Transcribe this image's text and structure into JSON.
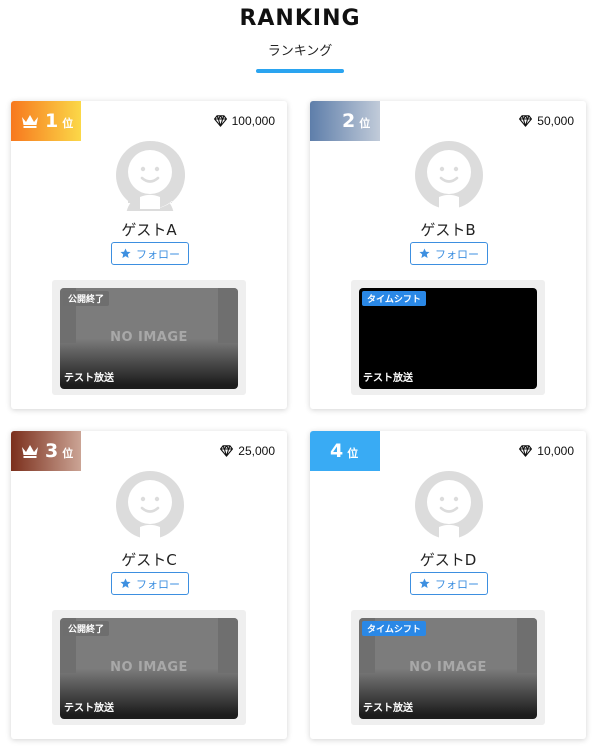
{
  "header": {
    "title": "RANKING",
    "subtitle": "ランキング"
  },
  "colors": {
    "accent": "#2aa4f0",
    "follow": "#3d8fe0",
    "rank1": [
      "#f7781e",
      "#fbd848"
    ],
    "rank2": [
      "#5e7eaa",
      "#c1cbd9"
    ],
    "rank3": [
      "#7b2f1c",
      "#cba495"
    ],
    "rank4": [
      "#39abf4",
      "#39abf4"
    ]
  },
  "cards": [
    {
      "rank": "1",
      "rank_unit": "位",
      "crown": true,
      "points": "100,000",
      "name": "ゲストA",
      "follow_label": "フォロー",
      "thumb_label": "公開終了",
      "thumb_title": "テスト放送",
      "no_image": "NO IMAGE"
    },
    {
      "rank": "2",
      "rank_unit": "位",
      "crown": false,
      "points": "50,000",
      "name": "ゲストB",
      "follow_label": "フォロー",
      "thumb_label": "タイムシフト",
      "thumb_title": "テスト放送",
      "no_image": ""
    },
    {
      "rank": "3",
      "rank_unit": "位",
      "crown": true,
      "points": "25,000",
      "name": "ゲストC",
      "follow_label": "フォロー",
      "thumb_label": "公開終了",
      "thumb_title": "テスト放送",
      "no_image": "NO IMAGE"
    },
    {
      "rank": "4",
      "rank_unit": "位",
      "crown": false,
      "points": "10,000",
      "name": "ゲストD",
      "follow_label": "フォロー",
      "thumb_label": "タイムシフト",
      "thumb_title": "テスト放送",
      "no_image": "NO IMAGE"
    }
  ]
}
